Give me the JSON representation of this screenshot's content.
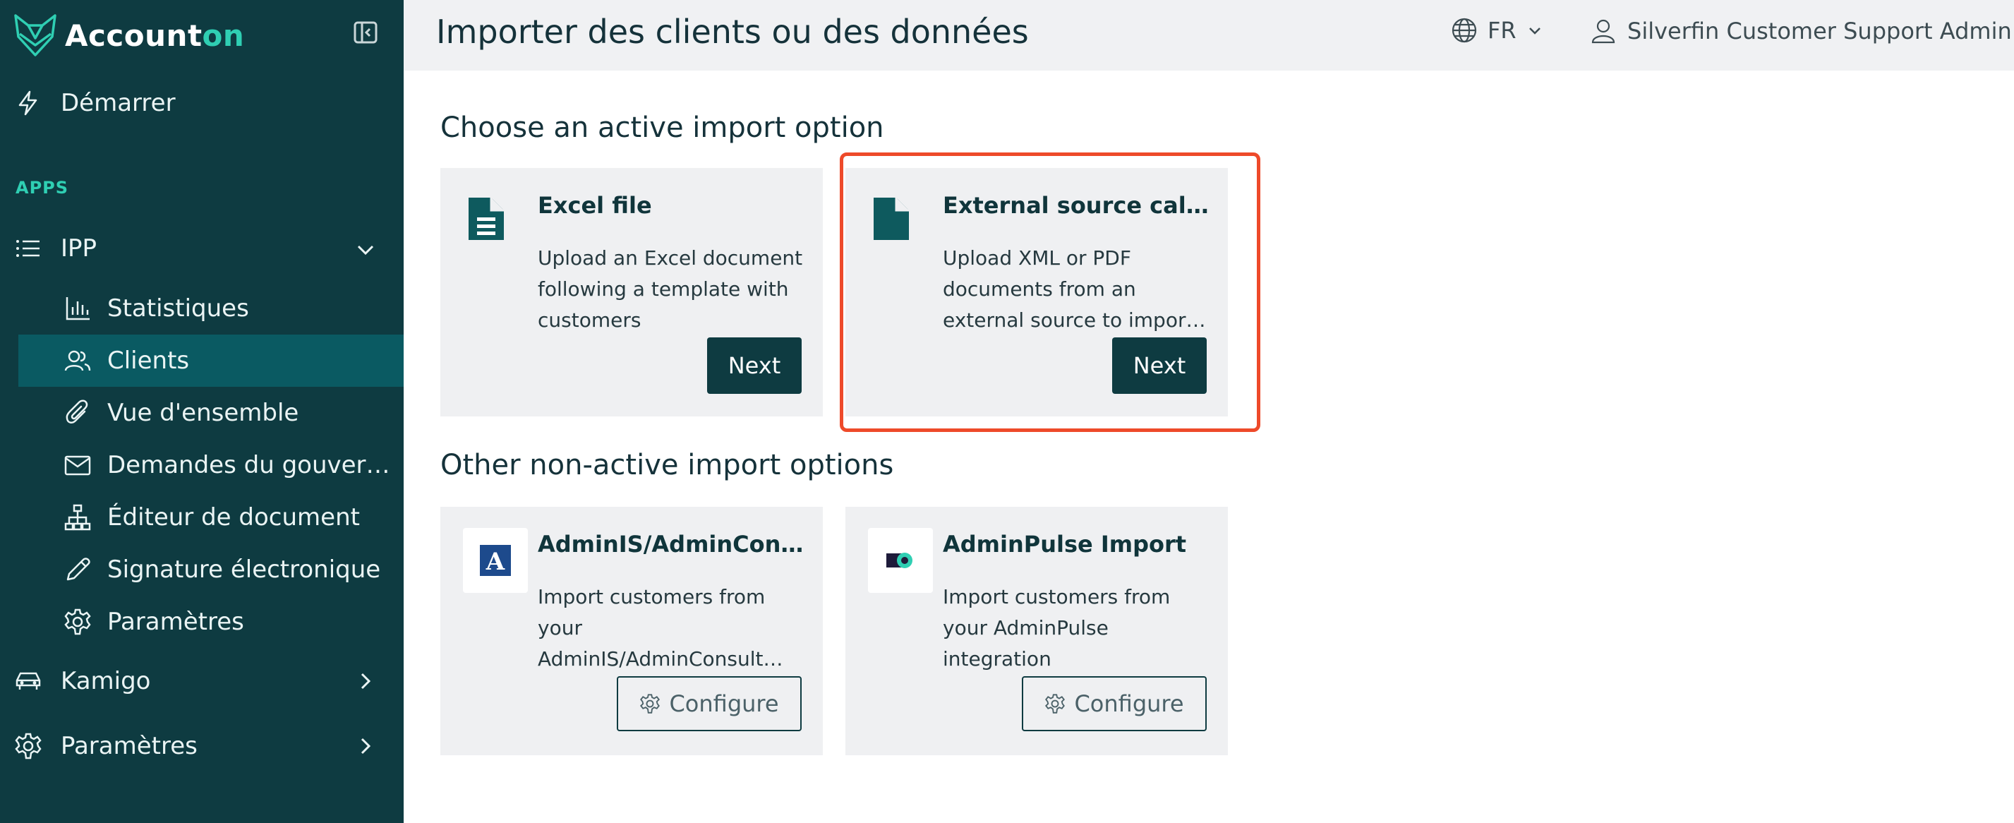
{
  "brand": {
    "name_part1": "Account",
    "name_part2": "on",
    "accent_color": "#2fcfb3"
  },
  "sidebar": {
    "start": "Démarrer",
    "apps_heading": "APPS",
    "ipp": {
      "label": "IPP",
      "items": [
        {
          "label": "Statistiques",
          "icon": "bar-chart-icon"
        },
        {
          "label": "Clients",
          "icon": "users-icon",
          "active": true
        },
        {
          "label": "Vue d'ensemble",
          "icon": "paperclip-icon"
        },
        {
          "label": "Demandes du gouver…",
          "icon": "mail-icon"
        },
        {
          "label": "Éditeur de document",
          "icon": "sitemap-icon"
        },
        {
          "label": "Signature électronique",
          "icon": "pen-icon"
        },
        {
          "label": "Paramètres",
          "icon": "gear-icon"
        }
      ]
    },
    "kamigo": "Kamigo",
    "settings": "Paramètres"
  },
  "header": {
    "title": "Importer des clients ou des données",
    "language": "FR",
    "user": "Silverfin Customer Support Admin"
  },
  "main": {
    "active_heading": "Choose an active import option",
    "inactive_heading": "Other non-active import options",
    "active_cards": [
      {
        "title": "Excel file",
        "desc_lines": [
          "Upload an Excel document",
          "following a template with",
          "customers"
        ],
        "button": "Next"
      },
      {
        "title": "External source calcul…",
        "desc_lines": [
          "Upload XML or PDF",
          "documents from an",
          "external source to import…"
        ],
        "button": "Next",
        "highlighted": true
      }
    ],
    "inactive_cards": [
      {
        "title": "AdminIS/AdminCons…",
        "desc_lines": [
          "Import customers from",
          "your",
          "AdminIS/AdminConsult…"
        ],
        "button": "Configure"
      },
      {
        "title": "AdminPulse Import",
        "desc_lines": [
          "Import customers from",
          "your AdminPulse",
          "integration"
        ],
        "button": "Configure"
      }
    ]
  },
  "colors": {
    "sidebar_bg": "#0e3b41",
    "active_item_bg": "#0a5a62",
    "highlight": "#ee4a2a",
    "button_dark": "#0e3b41"
  }
}
